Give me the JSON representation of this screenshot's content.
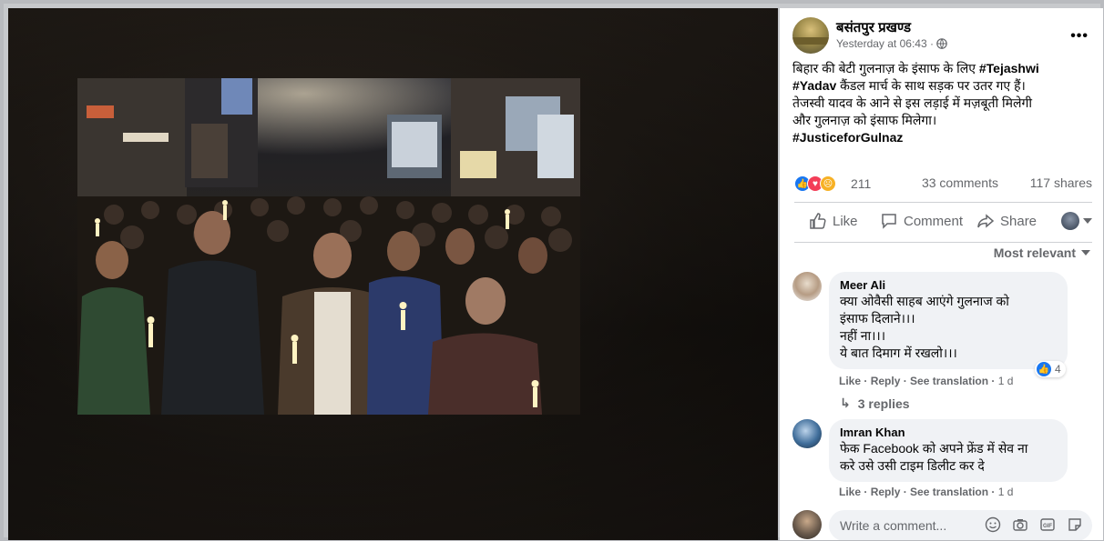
{
  "post": {
    "page_name": "बसंतपुर प्रखण्ड",
    "timestamp": "Yesterday at 06:43 ·",
    "audience_icon": "globe-icon",
    "text_line1": "बिहार की बेटी गुलनाज़ के इंसाफ के लिए ",
    "tag1": "#Tejashwi",
    "tag1b": "#Yadav",
    "text_line2": " कैंडल मार्च के साथ सड़क पर उतर गए हैं।",
    "text_line3": "तेजस्वी यादव के आने से इस लड़ाई में मज़बूती मिलेगी",
    "text_line4": "और गुलनाज़ को इंसाफ मिलेगा।",
    "tag2": "#JusticeforGulnaz"
  },
  "stats": {
    "reaction_count": "211",
    "comments": "33 comments",
    "shares": "117 shares"
  },
  "actions": {
    "like": "Like",
    "comment": "Comment",
    "share": "Share"
  },
  "sort": {
    "label": "Most relevant"
  },
  "comments": [
    {
      "name": "Meer Ali",
      "text": "क्या ओवैसी साहब आएंगे गुलनाज को\nइंसाफ दिलाने।।।\nनहीं ना।।।\nये बात दिमाग में रखलो।।।",
      "like": "Like",
      "reply": "Reply",
      "translate": "See translation",
      "age": "1 d",
      "likes": "4",
      "replies": "3 replies"
    },
    {
      "name": "Imran Khan",
      "text": "फेक Facebook को अपने फ्रेंड में सेव ना\nकरे उसे उसी टाइम डिलीट कर दे",
      "like": "Like",
      "reply": "Reply",
      "translate": "See translation",
      "age": "1 d"
    }
  ],
  "composer": {
    "placeholder": "Write a comment..."
  },
  "colors": {
    "accent": "#1877f2",
    "text_secondary": "#65676b",
    "bubble": "#f0f2f5"
  }
}
